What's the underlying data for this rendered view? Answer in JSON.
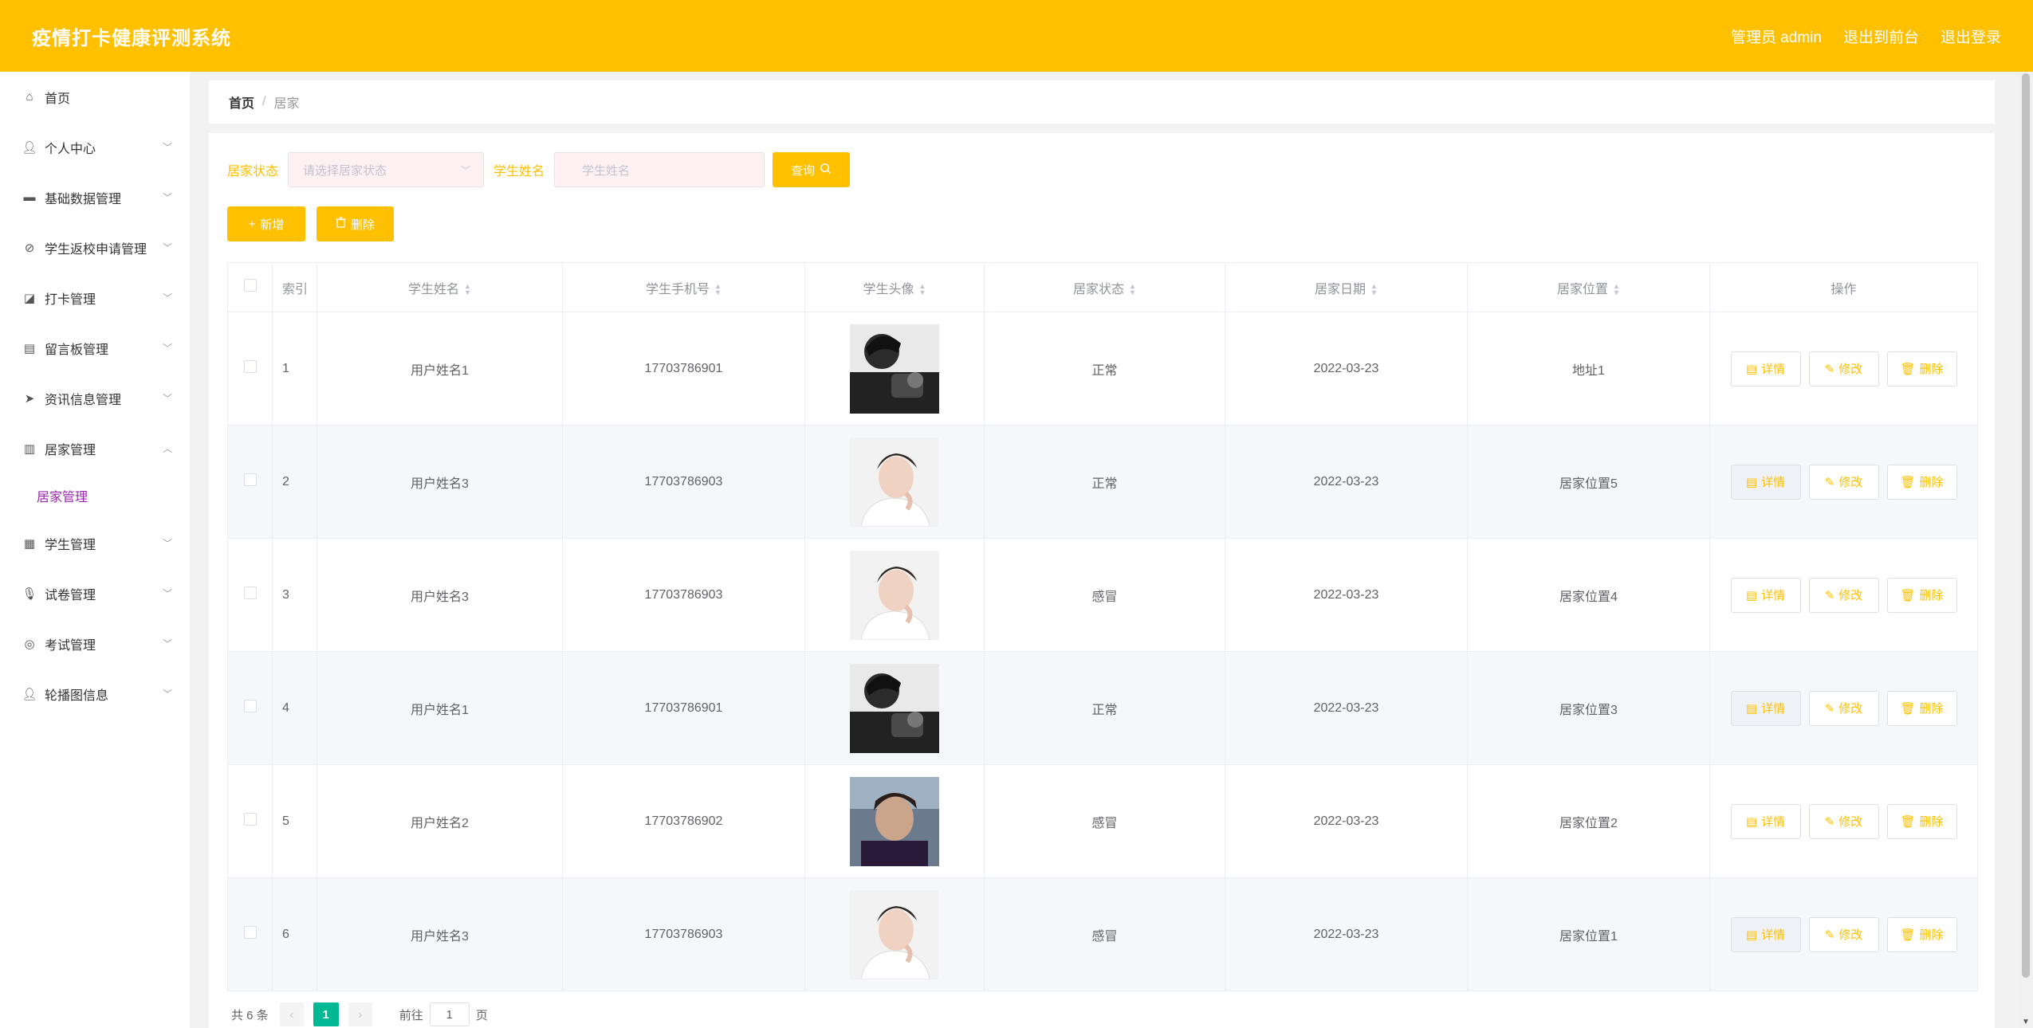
{
  "app": {
    "title": "疫情打卡健康评测系统"
  },
  "header": {
    "user": "管理员 admin",
    "front_link": "退出到前台",
    "logout_link": "退出登录"
  },
  "sidebar": {
    "items": [
      {
        "label": "首页",
        "icon": "home-icon"
      },
      {
        "label": "个人中心",
        "icon": "user-icon"
      },
      {
        "label": "基础数据管理",
        "icon": "data-icon"
      },
      {
        "label": "学生返校申请管理",
        "icon": "no-bell-icon"
      },
      {
        "label": "打卡管理",
        "icon": "chart-icon"
      },
      {
        "label": "留言板管理",
        "icon": "message-icon"
      },
      {
        "label": "资讯信息管理",
        "icon": "send-icon"
      },
      {
        "label": "居家管理",
        "icon": "bar-chart-icon"
      },
      {
        "label": "学生管理",
        "icon": "stats-icon"
      },
      {
        "label": "试卷管理",
        "icon": "mic-icon"
      },
      {
        "label": "考试管理",
        "icon": "compass-icon"
      },
      {
        "label": "轮播图信息",
        "icon": "user-icon"
      }
    ],
    "sub_item": "居家管理"
  },
  "breadcrumb": {
    "home": "首页",
    "sep": "/",
    "current": "居家"
  },
  "search": {
    "status_label": "居家状态",
    "status_placeholder": "请选择居家状态",
    "name_label": "学生姓名",
    "name_placeholder": "学生姓名",
    "query_button": "查询"
  },
  "actions": {
    "add": "新增",
    "delete": "删除"
  },
  "table": {
    "headers": [
      "索引",
      "学生姓名",
      "学生手机号",
      "学生头像",
      "居家状态",
      "居家日期",
      "居家位置",
      "操作"
    ],
    "ops": {
      "detail": "详情",
      "edit": "修改",
      "delete": "删除"
    },
    "rows": [
      {
        "idx": "1",
        "name": "用户姓名1",
        "phone": "17703786901",
        "status": "正常",
        "date": "2022-03-23",
        "location": "地址1"
      },
      {
        "idx": "2",
        "name": "用户姓名3",
        "phone": "17703786903",
        "status": "正常",
        "date": "2022-03-23",
        "location": "居家位置5"
      },
      {
        "idx": "3",
        "name": "用户姓名3",
        "phone": "17703786903",
        "status": "感冒",
        "date": "2022-03-23",
        "location": "居家位置4"
      },
      {
        "idx": "4",
        "name": "用户姓名1",
        "phone": "17703786901",
        "status": "正常",
        "date": "2022-03-23",
        "location": "居家位置3"
      },
      {
        "idx": "5",
        "name": "用户姓名2",
        "phone": "17703786902",
        "status": "感冒",
        "date": "2022-03-23",
        "location": "居家位置2"
      },
      {
        "idx": "6",
        "name": "用户姓名3",
        "phone": "17703786903",
        "status": "感冒",
        "date": "2022-03-23",
        "location": "居家位置1"
      }
    ]
  },
  "pager": {
    "total": "共 6 条",
    "page": "1",
    "goto": "前往",
    "input": "1",
    "unit": "页"
  },
  "colors": {
    "accent": "#ffc000",
    "pager_active": "#00b894",
    "submenu": "#9c27b0"
  }
}
